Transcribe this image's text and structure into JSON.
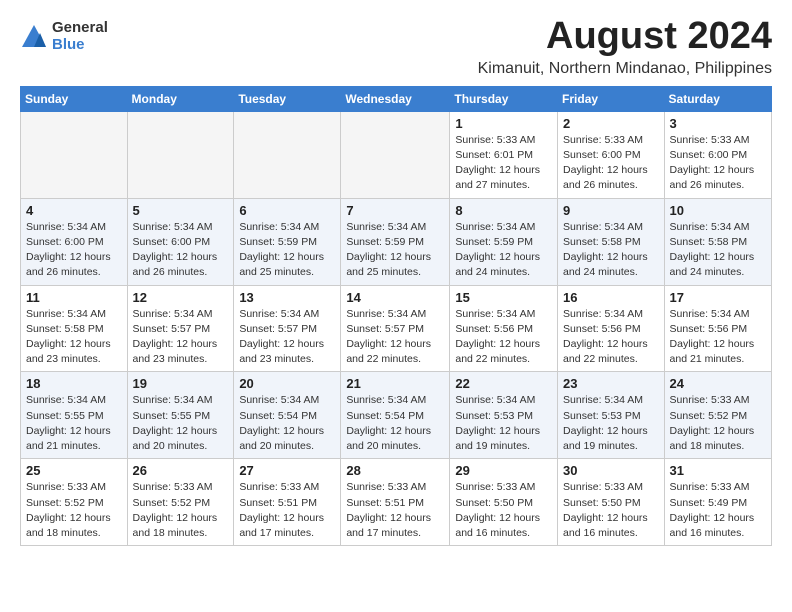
{
  "logo": {
    "general": "General",
    "blue": "Blue"
  },
  "title": "August 2024",
  "location": "Kimanuit, Northern Mindanao, Philippines",
  "days_of_week": [
    "Sunday",
    "Monday",
    "Tuesday",
    "Wednesday",
    "Thursday",
    "Friday",
    "Saturday"
  ],
  "weeks": [
    [
      {
        "day": "",
        "info": ""
      },
      {
        "day": "",
        "info": ""
      },
      {
        "day": "",
        "info": ""
      },
      {
        "day": "",
        "info": ""
      },
      {
        "day": "1",
        "info": "Sunrise: 5:33 AM\nSunset: 6:01 PM\nDaylight: 12 hours\nand 27 minutes."
      },
      {
        "day": "2",
        "info": "Sunrise: 5:33 AM\nSunset: 6:00 PM\nDaylight: 12 hours\nand 26 minutes."
      },
      {
        "day": "3",
        "info": "Sunrise: 5:33 AM\nSunset: 6:00 PM\nDaylight: 12 hours\nand 26 minutes."
      }
    ],
    [
      {
        "day": "4",
        "info": "Sunrise: 5:34 AM\nSunset: 6:00 PM\nDaylight: 12 hours\nand 26 minutes."
      },
      {
        "day": "5",
        "info": "Sunrise: 5:34 AM\nSunset: 6:00 PM\nDaylight: 12 hours\nand 26 minutes."
      },
      {
        "day": "6",
        "info": "Sunrise: 5:34 AM\nSunset: 5:59 PM\nDaylight: 12 hours\nand 25 minutes."
      },
      {
        "day": "7",
        "info": "Sunrise: 5:34 AM\nSunset: 5:59 PM\nDaylight: 12 hours\nand 25 minutes."
      },
      {
        "day": "8",
        "info": "Sunrise: 5:34 AM\nSunset: 5:59 PM\nDaylight: 12 hours\nand 24 minutes."
      },
      {
        "day": "9",
        "info": "Sunrise: 5:34 AM\nSunset: 5:58 PM\nDaylight: 12 hours\nand 24 minutes."
      },
      {
        "day": "10",
        "info": "Sunrise: 5:34 AM\nSunset: 5:58 PM\nDaylight: 12 hours\nand 24 minutes."
      }
    ],
    [
      {
        "day": "11",
        "info": "Sunrise: 5:34 AM\nSunset: 5:58 PM\nDaylight: 12 hours\nand 23 minutes."
      },
      {
        "day": "12",
        "info": "Sunrise: 5:34 AM\nSunset: 5:57 PM\nDaylight: 12 hours\nand 23 minutes."
      },
      {
        "day": "13",
        "info": "Sunrise: 5:34 AM\nSunset: 5:57 PM\nDaylight: 12 hours\nand 23 minutes."
      },
      {
        "day": "14",
        "info": "Sunrise: 5:34 AM\nSunset: 5:57 PM\nDaylight: 12 hours\nand 22 minutes."
      },
      {
        "day": "15",
        "info": "Sunrise: 5:34 AM\nSunset: 5:56 PM\nDaylight: 12 hours\nand 22 minutes."
      },
      {
        "day": "16",
        "info": "Sunrise: 5:34 AM\nSunset: 5:56 PM\nDaylight: 12 hours\nand 22 minutes."
      },
      {
        "day": "17",
        "info": "Sunrise: 5:34 AM\nSunset: 5:56 PM\nDaylight: 12 hours\nand 21 minutes."
      }
    ],
    [
      {
        "day": "18",
        "info": "Sunrise: 5:34 AM\nSunset: 5:55 PM\nDaylight: 12 hours\nand 21 minutes."
      },
      {
        "day": "19",
        "info": "Sunrise: 5:34 AM\nSunset: 5:55 PM\nDaylight: 12 hours\nand 20 minutes."
      },
      {
        "day": "20",
        "info": "Sunrise: 5:34 AM\nSunset: 5:54 PM\nDaylight: 12 hours\nand 20 minutes."
      },
      {
        "day": "21",
        "info": "Sunrise: 5:34 AM\nSunset: 5:54 PM\nDaylight: 12 hours\nand 20 minutes."
      },
      {
        "day": "22",
        "info": "Sunrise: 5:34 AM\nSunset: 5:53 PM\nDaylight: 12 hours\nand 19 minutes."
      },
      {
        "day": "23",
        "info": "Sunrise: 5:34 AM\nSunset: 5:53 PM\nDaylight: 12 hours\nand 19 minutes."
      },
      {
        "day": "24",
        "info": "Sunrise: 5:33 AM\nSunset: 5:52 PM\nDaylight: 12 hours\nand 18 minutes."
      }
    ],
    [
      {
        "day": "25",
        "info": "Sunrise: 5:33 AM\nSunset: 5:52 PM\nDaylight: 12 hours\nand 18 minutes."
      },
      {
        "day": "26",
        "info": "Sunrise: 5:33 AM\nSunset: 5:52 PM\nDaylight: 12 hours\nand 18 minutes."
      },
      {
        "day": "27",
        "info": "Sunrise: 5:33 AM\nSunset: 5:51 PM\nDaylight: 12 hours\nand 17 minutes."
      },
      {
        "day": "28",
        "info": "Sunrise: 5:33 AM\nSunset: 5:51 PM\nDaylight: 12 hours\nand 17 minutes."
      },
      {
        "day": "29",
        "info": "Sunrise: 5:33 AM\nSunset: 5:50 PM\nDaylight: 12 hours\nand 16 minutes."
      },
      {
        "day": "30",
        "info": "Sunrise: 5:33 AM\nSunset: 5:50 PM\nDaylight: 12 hours\nand 16 minutes."
      },
      {
        "day": "31",
        "info": "Sunrise: 5:33 AM\nSunset: 5:49 PM\nDaylight: 12 hours\nand 16 minutes."
      }
    ]
  ]
}
